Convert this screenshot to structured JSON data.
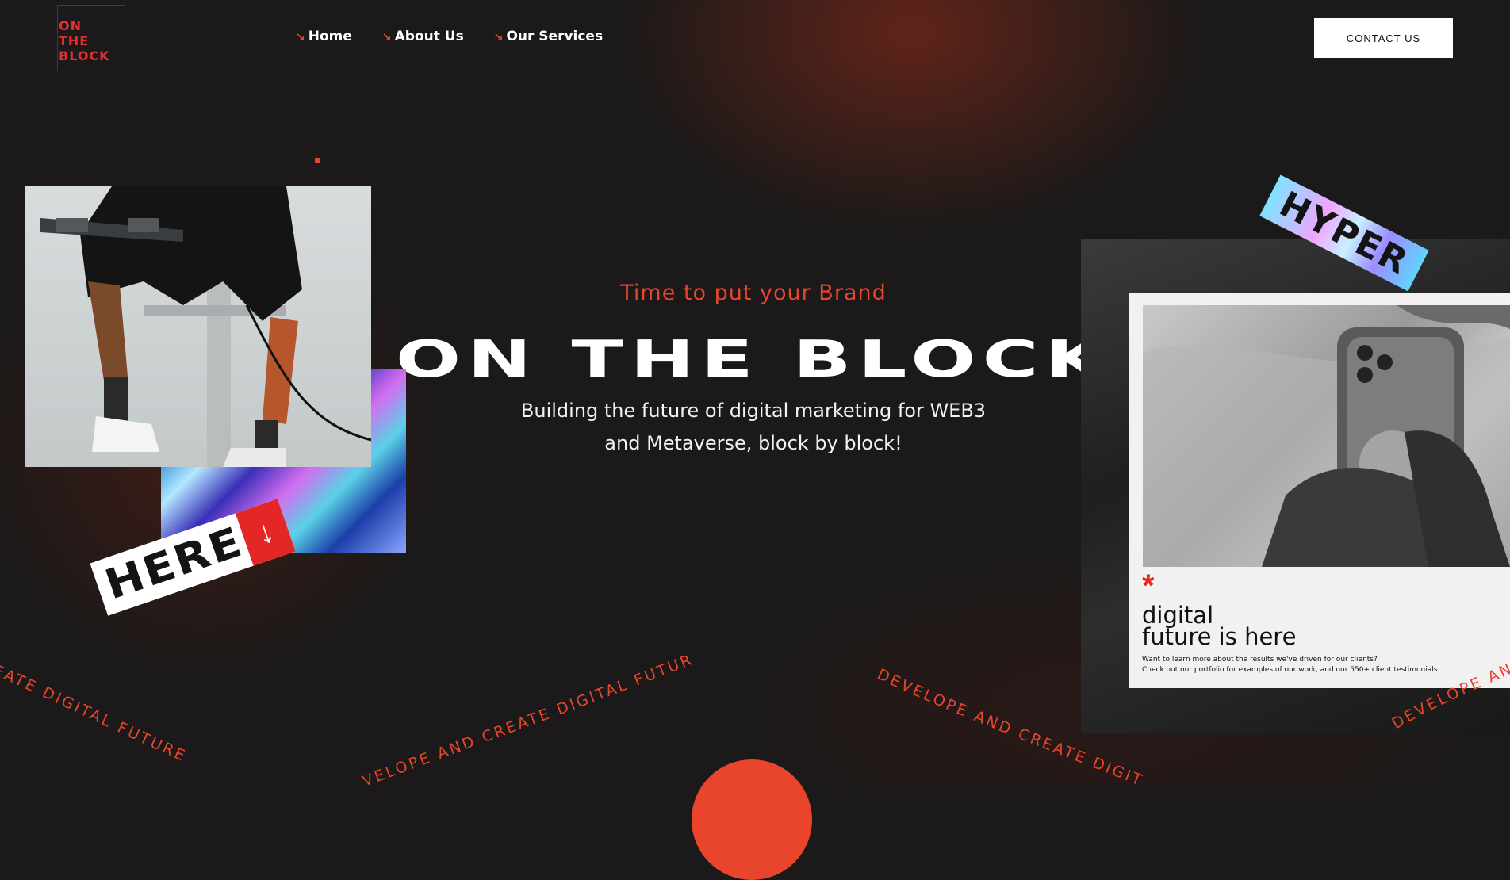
{
  "brand": {
    "logo_lines": [
      "ON",
      "THE",
      "BLOCK"
    ],
    "accent": "#e8452c",
    "logo_red": "#e23030"
  },
  "nav": [
    {
      "label": "Home",
      "icon": "arrow-down-right-icon"
    },
    {
      "label": "About Us",
      "icon": "arrow-down-right-icon"
    },
    {
      "label": "Our Services",
      "icon": "arrow-down-right-icon"
    }
  ],
  "header": {
    "contact_label": "CONTACT US"
  },
  "hero": {
    "tagline": "Time to put your Brand",
    "title": "ON THE BLOCK",
    "subtitle_line1": "Building the future of digital marketing for WEB3",
    "subtitle_line2": "and Metaverse, block by block!"
  },
  "stickers": {
    "here": "HERE",
    "here_icon": "arrow-down-icon",
    "hyper": "HYPER"
  },
  "poster": {
    "star": "*",
    "title_line1": "digital",
    "title_line2": "future is here",
    "text_line1": "Want to learn more about the results we've driven for our clients?",
    "text_line2": "Check out our portfolio for examples of our work, and our 550+ client testimonials"
  },
  "ribbons": {
    "left": "EATE  DIGITAL  FUTURE",
    "center": "VELOPE  AND  CREATE  DIGITAL  FUTURE",
    "right": "DEVELOPE  AND  CREATE  DIGITA",
    "far_right": "DEVELOPE  AND"
  }
}
